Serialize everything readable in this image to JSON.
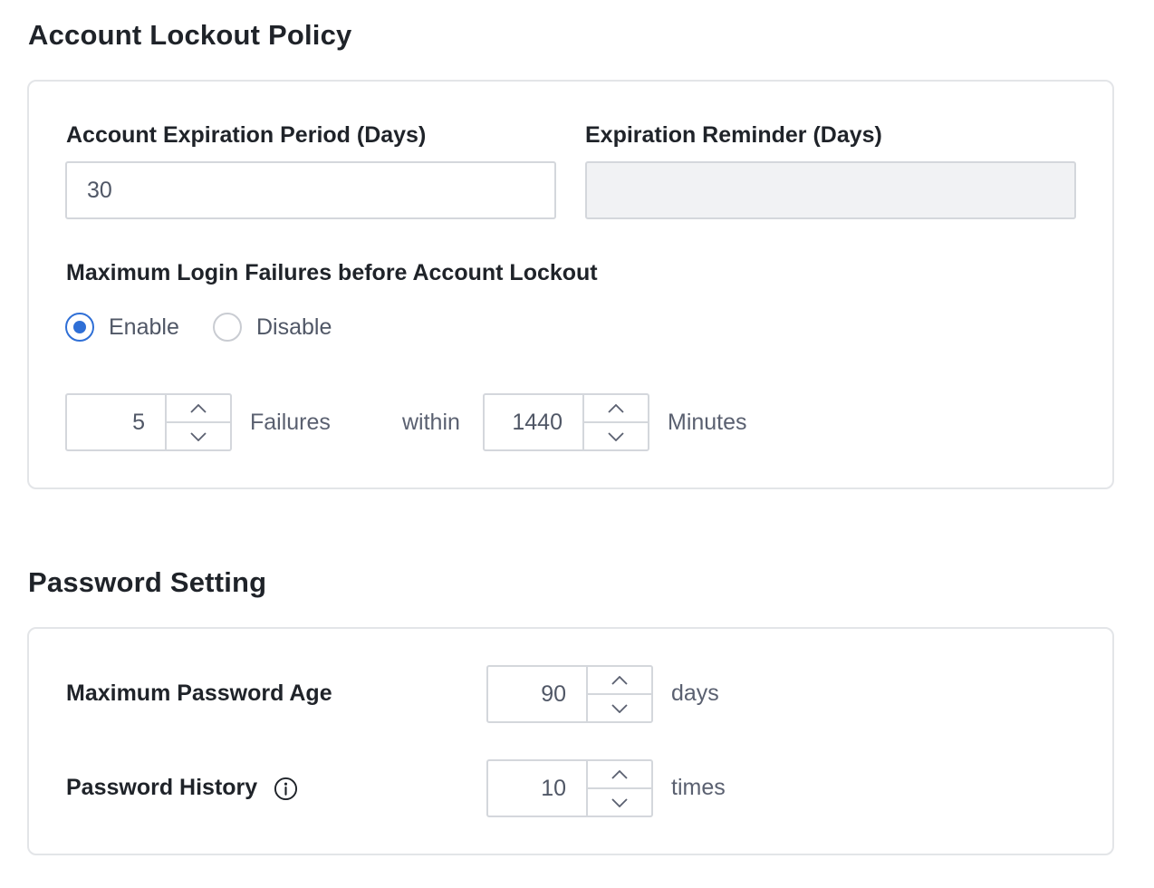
{
  "lockout": {
    "title": "Account Lockout Policy",
    "expiration_label": "Account Expiration Period (Days)",
    "expiration_value": "30",
    "reminder_label": "Expiration Reminder (Days)",
    "reminder_value": "",
    "max_failures_label": "Maximum Login Failures before Account Lockout",
    "enable_label": "Enable",
    "disable_label": "Disable",
    "selected": "Enable",
    "failures_value": "5",
    "failures_unit": "Failures",
    "within_label": "within",
    "minutes_value": "1440",
    "minutes_unit": "Minutes"
  },
  "password": {
    "title": "Password Setting",
    "max_age_label": "Maximum Password Age",
    "max_age_value": "90",
    "max_age_unit": "days",
    "history_label": "Password History",
    "history_value": "10",
    "history_unit": "times"
  },
  "icons": {
    "up": "chevron-up-icon",
    "down": "chevron-down-icon",
    "info": "info-icon"
  },
  "colors": {
    "accent": "#2f6fd6",
    "border": "#d4d7dc",
    "disabled_bg": "#f1f2f4"
  }
}
